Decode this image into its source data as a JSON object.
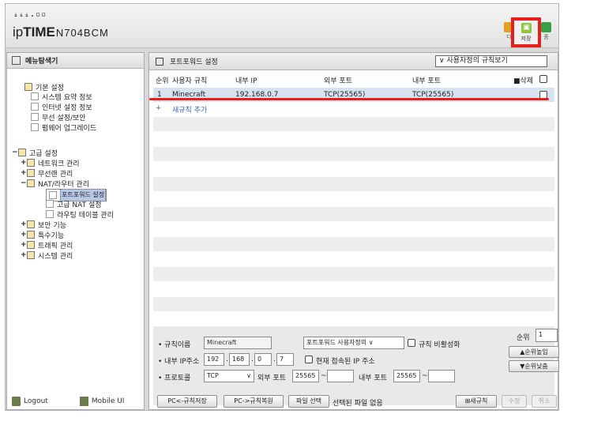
{
  "header": {
    "logo_dots": "ᵢᵢᵢ.▫▫",
    "logo_ip": "ip",
    "logo_time": "TIME",
    "logo_model": "N704BCM",
    "buttons": [
      {
        "label": "다",
        "color": "#e0a020"
      },
      {
        "label": "저장",
        "color": "#8cc63f"
      },
      {
        "label": "종",
        "color": "#38a048"
      }
    ]
  },
  "left": {
    "title": "메뉴탐색기",
    "tree": [
      {
        "label": "기본 설정",
        "toggle": "",
        "level": 0
      },
      {
        "label": "시스템 요약 정보",
        "toggle": "",
        "level": 1
      },
      {
        "label": "인터넷 설정 정보",
        "toggle": "",
        "level": 1
      },
      {
        "label": "무선 설정/보안",
        "toggle": "",
        "level": 1
      },
      {
        "label": "펌웨어 업그레이드",
        "toggle": "",
        "level": 1
      },
      {
        "label": "고급 설정",
        "toggle": "−",
        "level": 0
      },
      {
        "label": "네트워크 관리",
        "toggle": "+",
        "level": 1
      },
      {
        "label": "무선랜 관리",
        "toggle": "+",
        "level": 1
      },
      {
        "label": "NAT/라우터 관리",
        "toggle": "−",
        "level": 1
      },
      {
        "label": "포트포워드 설정",
        "toggle": "",
        "level": 2
      },
      {
        "label": "고급 NAT 설정",
        "toggle": "",
        "level": 2
      },
      {
        "label": "라우팅 테이블 관리",
        "toggle": "",
        "level": 2
      },
      {
        "label": "보안 기능",
        "toggle": "+",
        "level": 1
      },
      {
        "label": "특수기능",
        "toggle": "+",
        "level": 1
      },
      {
        "label": "트래픽 관리",
        "toggle": "+",
        "level": 1
      },
      {
        "label": "시스템 관리",
        "toggle": "+",
        "level": 1
      }
    ],
    "logout": "Logout",
    "mobile": "Mobile UI"
  },
  "right": {
    "title": "포트포워드 설정",
    "view_select": "∨ 사용자정의 규칙보기",
    "columns": {
      "no": "순위",
      "rule": "사용자 규칙",
      "internal_ip": "내부 IP",
      "external_port": "외부 포트",
      "internal_port": "내부 포트",
      "delete": "■삭제"
    },
    "rows": [
      {
        "no": "1",
        "rule": "Minecraft",
        "internal_ip": "192.168.0.7",
        "external_port": "TCP(25565)",
        "internal_port": "TCP(25565)"
      }
    ],
    "add_rule": "새규칙 추가",
    "form": {
      "rule_name_label": "• 규칙이름",
      "rule_name": "Minecraft",
      "rule_type": "포트포워드 사용자정의",
      "disable_label": "규칙 비활성화",
      "priority_label": "순위",
      "priority": "1",
      "up_btn": "순위높임",
      "down_btn": "순위낮춤",
      "ip_label": "• 내부 IP주소",
      "ip": [
        "192",
        "168",
        "0",
        "7"
      ],
      "current_ip_label": "현재 접속된 IP 주소",
      "protocol_label": "• 프로토콜",
      "protocol": "TCP",
      "ext_port_label": "외부 포트",
      "ext_port_from": "25565",
      "ext_port_to": "",
      "int_port_label": "내부 포트",
      "int_port_from": "25565",
      "int_port_to": "",
      "save_pc_btn": "PC<-규칙저장",
      "restore_pc_btn": "PC->규칙복원",
      "file_btn": "파일 선택",
      "file_none": "선택된 파일 없음",
      "new_rule_btn": "새규칙",
      "edit_btn": "수정",
      "cancel_btn": "취소"
    }
  }
}
